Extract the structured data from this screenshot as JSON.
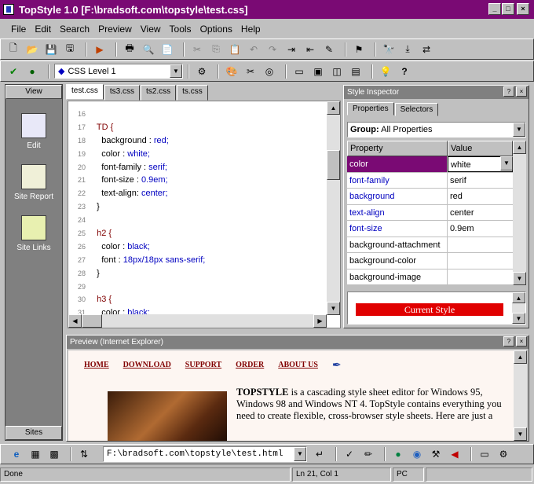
{
  "window": {
    "title": "TopStyle 1.0 [F:\\bradsoft.com\\topstyle\\test.css]",
    "controls": [
      "_",
      "□",
      "×"
    ]
  },
  "menu": [
    "File",
    "Edit",
    "Search",
    "Preview",
    "View",
    "Tools",
    "Options",
    "Help"
  ],
  "toolbar2": {
    "css_level": "CSS Level 1"
  },
  "sidebar": {
    "header": "View",
    "items": [
      {
        "label": "Edit",
        "icon": "edit-icon"
      },
      {
        "label": "Site Report",
        "icon": "report-icon"
      },
      {
        "label": "Site Links",
        "icon": "links-icon"
      }
    ],
    "footer": "Sites"
  },
  "tabs": [
    "test.css",
    "ts3.css",
    "ts2.css",
    "ts.css"
  ],
  "editor": {
    "lines": [
      {
        "n": "16",
        "parts": []
      },
      {
        "n": "17",
        "parts": [
          {
            "t": "  TD {",
            "c": "sel"
          }
        ]
      },
      {
        "n": "18",
        "parts": [
          {
            "t": "    background : ",
            "c": "prop"
          },
          {
            "t": "red;",
            "c": "val"
          }
        ]
      },
      {
        "n": "19",
        "parts": [
          {
            "t": "    color : ",
            "c": "prop"
          },
          {
            "t": "white;",
            "c": "val"
          }
        ]
      },
      {
        "n": "20",
        "parts": [
          {
            "t": "    font-family : ",
            "c": "prop"
          },
          {
            "t": "serif;",
            "c": "val"
          }
        ]
      },
      {
        "n": "21",
        "parts": [
          {
            "t": "    font-size : ",
            "c": "prop"
          },
          {
            "t": "0.9em;",
            "c": "val"
          }
        ]
      },
      {
        "n": "22",
        "parts": [
          {
            "t": "    text-align: ",
            "c": "prop"
          },
          {
            "t": "center;",
            "c": "val"
          }
        ]
      },
      {
        "n": "23",
        "parts": [
          {
            "t": "  }",
            "c": "prop"
          }
        ]
      },
      {
        "n": "24",
        "parts": []
      },
      {
        "n": "25",
        "parts": [
          {
            "t": "  h2 {",
            "c": "sel"
          }
        ]
      },
      {
        "n": "26",
        "parts": [
          {
            "t": "    color : ",
            "c": "prop"
          },
          {
            "t": "black;",
            "c": "val"
          }
        ]
      },
      {
        "n": "27",
        "parts": [
          {
            "t": "    font : ",
            "c": "prop"
          },
          {
            "t": "18px/18px sans-serif;",
            "c": "val"
          }
        ]
      },
      {
        "n": "28",
        "parts": [
          {
            "t": "  }",
            "c": "prop"
          }
        ]
      },
      {
        "n": "29",
        "parts": []
      },
      {
        "n": "30",
        "parts": [
          {
            "t": "  h3 {",
            "c": "sel"
          }
        ]
      },
      {
        "n": "31",
        "parts": [
          {
            "t": "    color : ",
            "c": "prop"
          },
          {
            "t": "black;",
            "c": "val"
          }
        ]
      }
    ]
  },
  "inspector": {
    "title": "Style Inspector",
    "tabs": [
      "Properties",
      "Selectors"
    ],
    "group_label": "Group:",
    "group_value": "All Properties",
    "columns": [
      "Property",
      "Value"
    ],
    "rows": [
      {
        "property": "color",
        "value": "white",
        "selected": true,
        "link": true
      },
      {
        "property": "font-family",
        "value": "serif",
        "link": true
      },
      {
        "property": "background",
        "value": "red",
        "link": true
      },
      {
        "property": "text-align",
        "value": "center",
        "link": true
      },
      {
        "property": "font-size",
        "value": "0.9em",
        "link": true
      },
      {
        "property": "background-attachment",
        "value": "",
        "link": false
      },
      {
        "property": "background-color",
        "value": "",
        "link": false
      },
      {
        "property": "background-image",
        "value": "",
        "link": false
      }
    ],
    "current_style": "Current Style"
  },
  "preview": {
    "title": "Preview (Internet Explorer)",
    "nav": [
      "HOME",
      "DOWNLOAD",
      "SUPPORT",
      "ORDER",
      "ABOUT US"
    ],
    "text_bold": "TOPSTYLE",
    "text": " is a cascading style sheet editor for Windows 95, Windows 98 and Windows NT 4. TopStyle contains everything you need to create flexible, cross-browser style sheets. Here are just a"
  },
  "address": "F:\\bradsoft.com\\topstyle\\test.html",
  "status": {
    "left": "Done",
    "pos": "Ln 21, Col 1",
    "mode": "PC"
  },
  "colors": {
    "title": "#7a0a74",
    "selection": "#7a0a74",
    "current_style": "#e00000",
    "link": "#0000c0"
  }
}
